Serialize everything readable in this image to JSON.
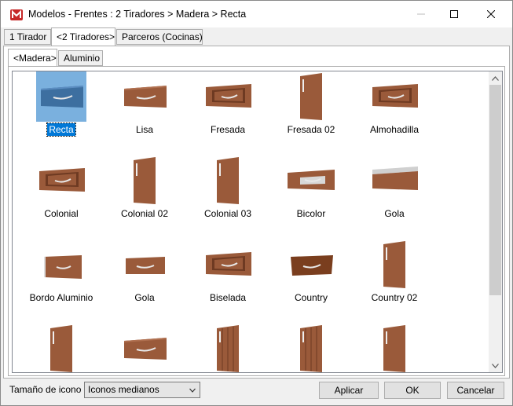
{
  "window": {
    "title": "Modelos - Frentes : 2 Tiradores > Madera > Recta",
    "app_icon": "m-logo-icon"
  },
  "tabs_primary": [
    {
      "label": "1 Tirador",
      "active": false
    },
    {
      "label": "<2 Tiradores>",
      "active": true
    },
    {
      "label": "Parceros (Cocinas)",
      "active": false
    }
  ],
  "tabs_secondary": [
    {
      "label": "<Madera>",
      "active": true
    },
    {
      "label": "Aluminio",
      "active": false
    }
  ],
  "items": [
    {
      "label": "Recta",
      "kind": "slab",
      "selected": true
    },
    {
      "label": "Lisa",
      "kind": "slab"
    },
    {
      "label": "Fresada",
      "kind": "frame"
    },
    {
      "label": "Fresada 02",
      "kind": "door"
    },
    {
      "label": "Almohadilla",
      "kind": "frame"
    },
    {
      "label": "Colonial",
      "kind": "frame"
    },
    {
      "label": "Colonial 02",
      "kind": "door"
    },
    {
      "label": "Colonial 03",
      "kind": "door"
    },
    {
      "label": "Bicolor",
      "kind": "bicolor"
    },
    {
      "label": "Gola",
      "kind": "gola"
    },
    {
      "label": "Bordo Aluminio",
      "kind": "alu"
    },
    {
      "label": "Gola",
      "kind": "slabshort"
    },
    {
      "label": "Biselada",
      "kind": "frame"
    },
    {
      "label": "Country",
      "kind": "country"
    },
    {
      "label": "Country 02",
      "kind": "door"
    },
    {
      "label": "",
      "kind": "door"
    },
    {
      "label": "",
      "kind": "slab"
    },
    {
      "label": "",
      "kind": "doorlines"
    },
    {
      "label": "",
      "kind": "doorlines"
    },
    {
      "label": "",
      "kind": "door"
    }
  ],
  "footer": {
    "icon_size_label": "Tamaño de icono",
    "icon_size_value": "Iconos medianos",
    "apply_label": "Aplicar",
    "ok_label": "OK",
    "cancel_label": "Cancelar"
  },
  "colors": {
    "wood": "#9a5a3a",
    "wood_dark": "#6e3a22",
    "selected_bg": "#7ab0de",
    "selection": "#0078d7"
  }
}
